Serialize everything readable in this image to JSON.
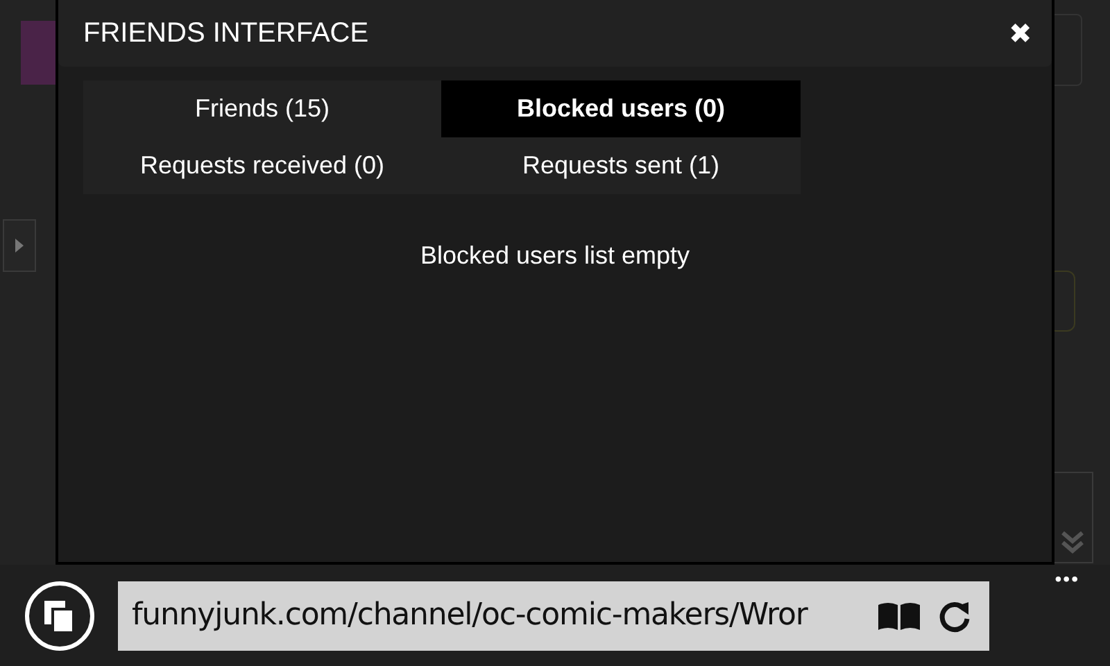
{
  "dialog": {
    "title": "FRIENDS INTERFACE",
    "close": "✖"
  },
  "tabs": [
    {
      "label": "Friends (15)",
      "selected": false
    },
    {
      "label": "Blocked users (0)",
      "selected": true
    },
    {
      "label": "Requests received (0)",
      "selected": false
    },
    {
      "label": "Requests sent (1)",
      "selected": false
    }
  ],
  "message": "Blocked users list empty",
  "browser_bar": {
    "address": "funnyjunk.com/channel/oc-comic-makers/Wror",
    "more": "•••"
  }
}
